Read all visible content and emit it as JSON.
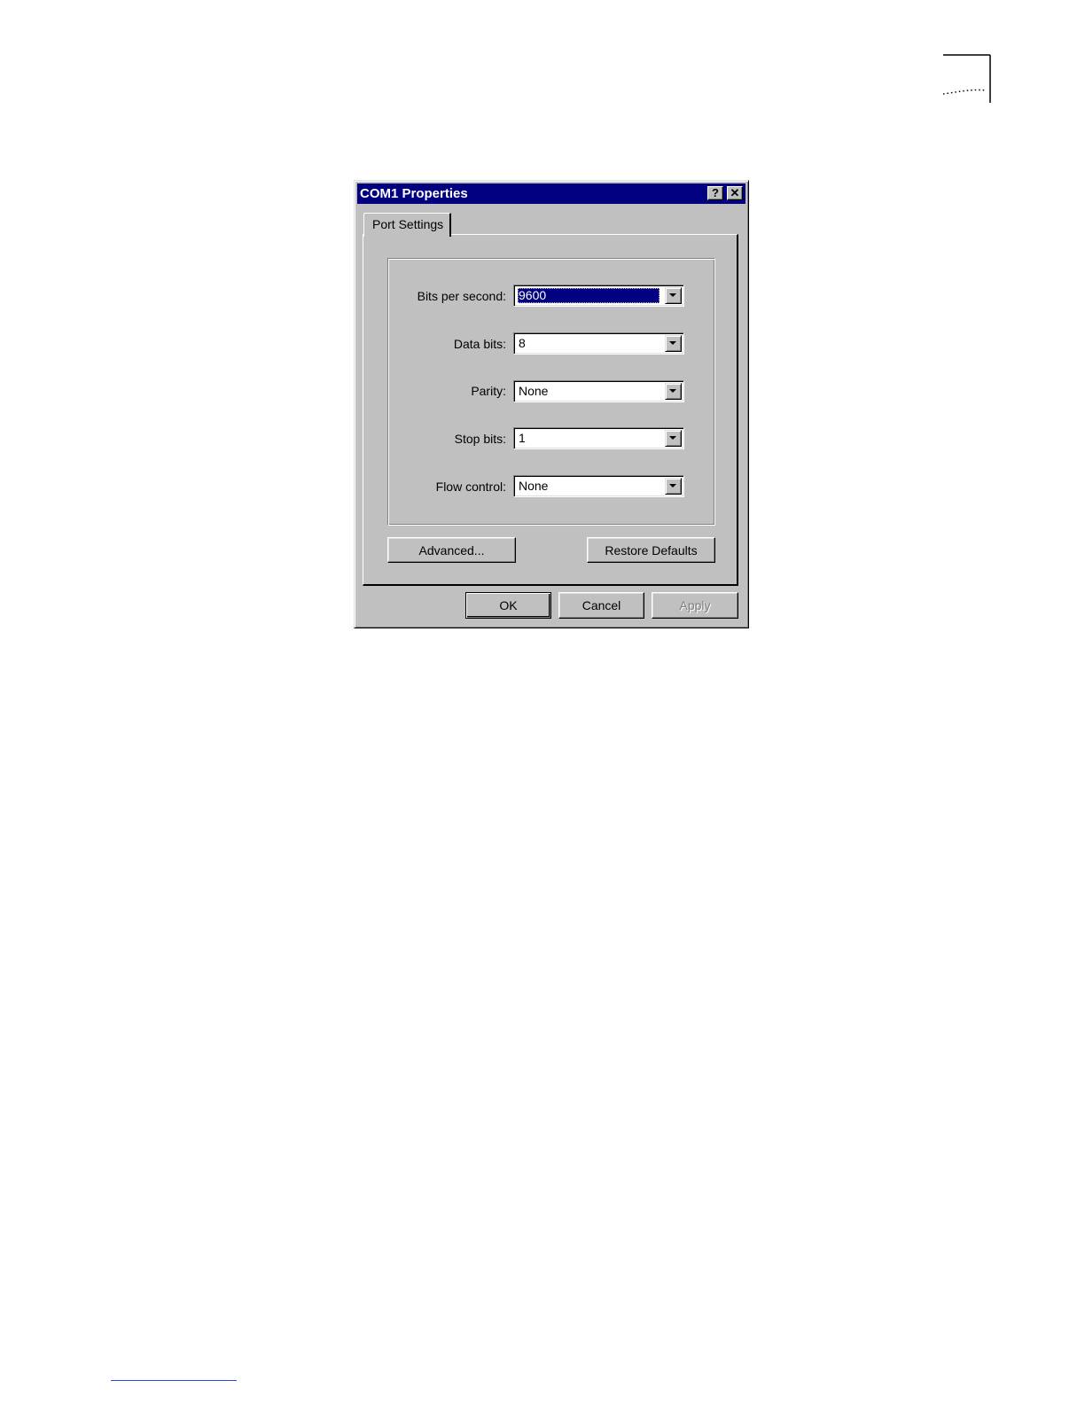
{
  "dialog": {
    "title": "COM1 Properties",
    "help_button": "?",
    "close_button": "✕",
    "tab": "Port Settings",
    "fields": [
      {
        "label": "Bits per second:",
        "value": "9600"
      },
      {
        "label": "Data bits:",
        "value": "8"
      },
      {
        "label": "Parity:",
        "value": "None"
      },
      {
        "label": "Stop bits:",
        "value": "1"
      },
      {
        "label": "Flow control:",
        "value": "None"
      }
    ],
    "advanced_button": "Advanced...",
    "restore_button": "Restore Defaults",
    "ok_button": "OK",
    "cancel_button": "Cancel",
    "apply_button": "Apply"
  },
  "colors": {
    "titlebar": "#000080",
    "face": "#c0c0c0",
    "selection": "#000080"
  },
  "icons": {
    "help": "question-mark",
    "close": "x-mark",
    "dropdown": "triangle-down",
    "corner_mark": "page-corner-bracket"
  }
}
